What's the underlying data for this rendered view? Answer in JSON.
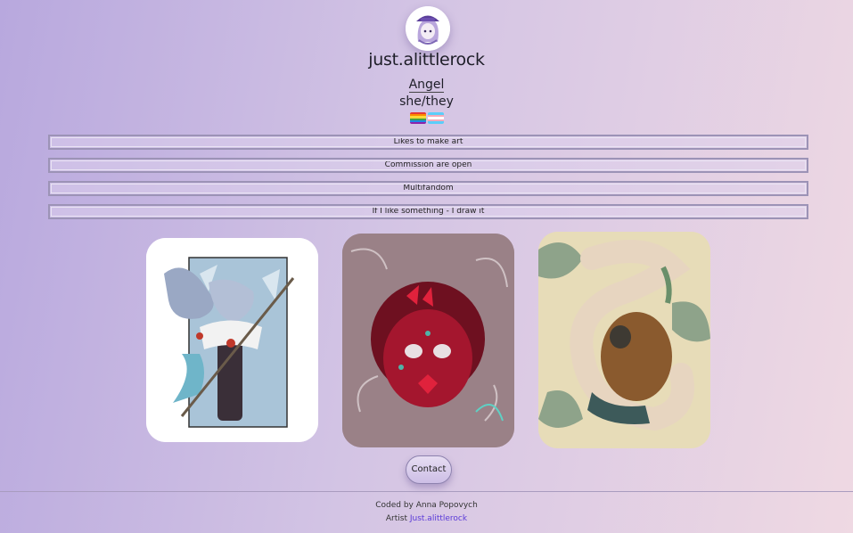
{
  "profile": {
    "username": "just.alittlerock",
    "name": "Angel",
    "pronouns": "she/they",
    "flags": [
      "rainbow-pride-flag",
      "transgender-flag"
    ]
  },
  "bars": [
    {
      "label": "Likes to make art"
    },
    {
      "label": "Commission are open"
    },
    {
      "label": "Multifandom"
    },
    {
      "label": "If I like something - I draw it"
    }
  ],
  "gallery": [
    {
      "name": "artwork-winter-warrior"
    },
    {
      "name": "artwork-red-butterfly-face"
    },
    {
      "name": "artwork-snake-and-figure"
    }
  ],
  "contact": {
    "label": "Contact"
  },
  "footer": {
    "coded_by": "Coded by Anna Popovych",
    "artist_prefix": "Artist",
    "artist_link": "Just.alittlerock"
  },
  "colors": {
    "accent_link": "#5a3ad8",
    "background_start": "#b8a8de",
    "background_end": "#efd9e3"
  }
}
